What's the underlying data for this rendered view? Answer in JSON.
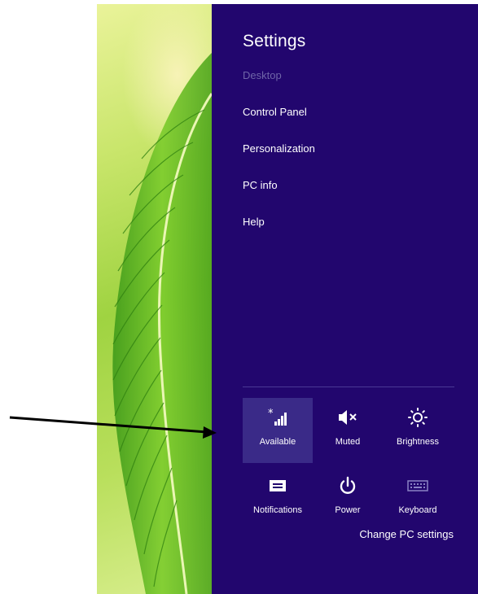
{
  "charm": {
    "title": "Settings",
    "menu": [
      {
        "label": "Desktop",
        "state": "disabled"
      },
      {
        "label": "Control Panel"
      },
      {
        "label": "Personalization"
      },
      {
        "label": "PC info"
      },
      {
        "label": "Help"
      }
    ],
    "tiles": [
      {
        "label": "Available",
        "icon": "network-signal-icon",
        "active": true
      },
      {
        "label": "Muted",
        "icon": "speaker-muted-icon"
      },
      {
        "label": "Brightness",
        "icon": "brightness-icon"
      },
      {
        "label": "Notifications",
        "icon": "notifications-icon"
      },
      {
        "label": "Power",
        "icon": "power-icon"
      },
      {
        "label": "Keyboard",
        "icon": "keyboard-icon"
      }
    ],
    "change_settings": "Change PC settings"
  },
  "colors": {
    "charm_background": "#22066e",
    "active_tile": "#3a2a88",
    "disabled_text": "#6f65a8",
    "wallpaper_leaf": "#9fd341"
  }
}
